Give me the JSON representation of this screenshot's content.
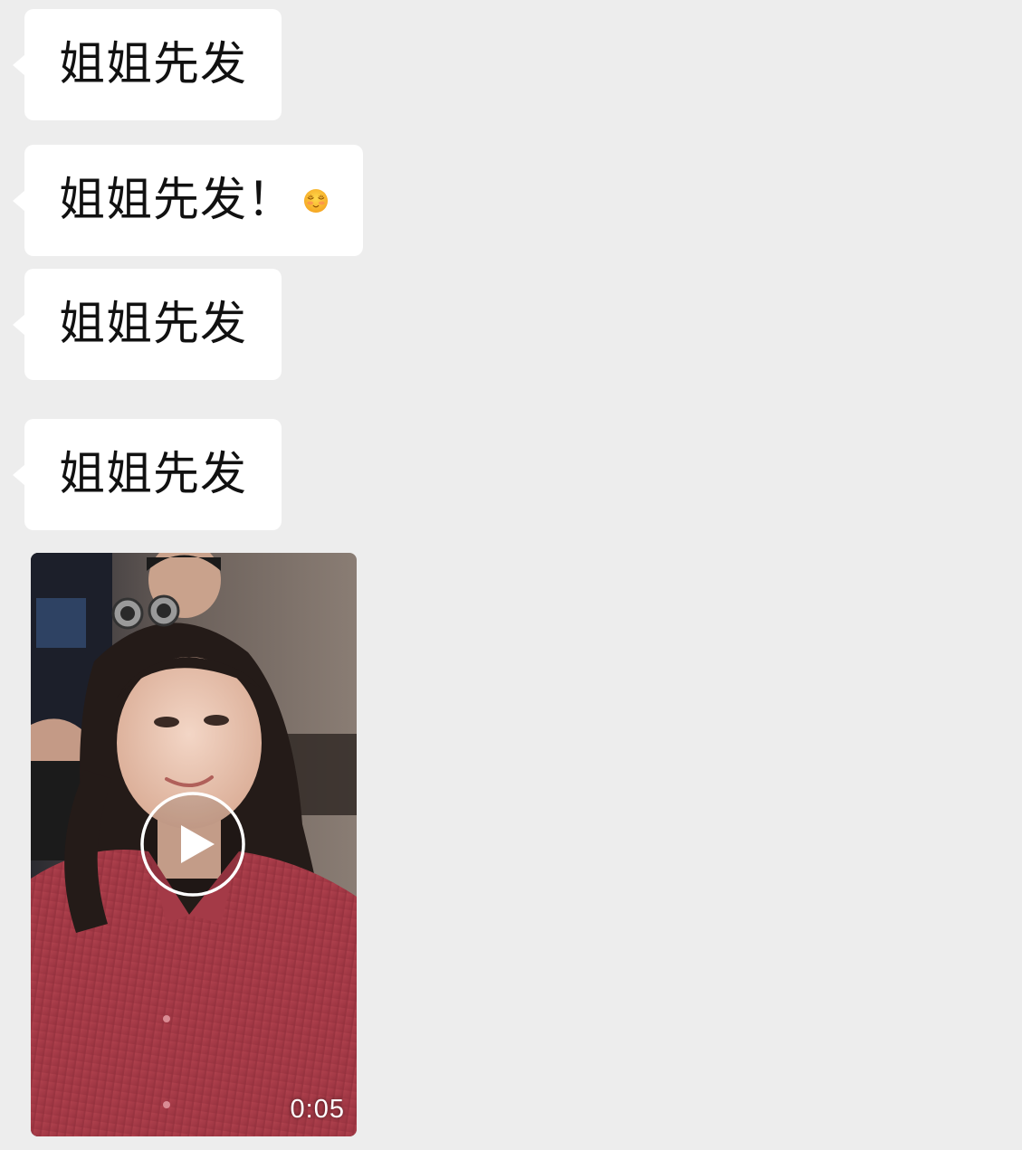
{
  "chat": {
    "messages": [
      {
        "text": "姐姐先发"
      },
      {
        "text": "姐姐先发！",
        "emoji": "smiling-face-with-closed-eyes-emoji"
      },
      {
        "text": "姐姐先发"
      },
      {
        "text": "姐姐先发"
      }
    ],
    "video": {
      "duration": "0:05",
      "play_icon": "play-circle-icon"
    }
  },
  "colors": {
    "background": "#ededed",
    "bubble": "#ffffff",
    "text": "#111111"
  }
}
